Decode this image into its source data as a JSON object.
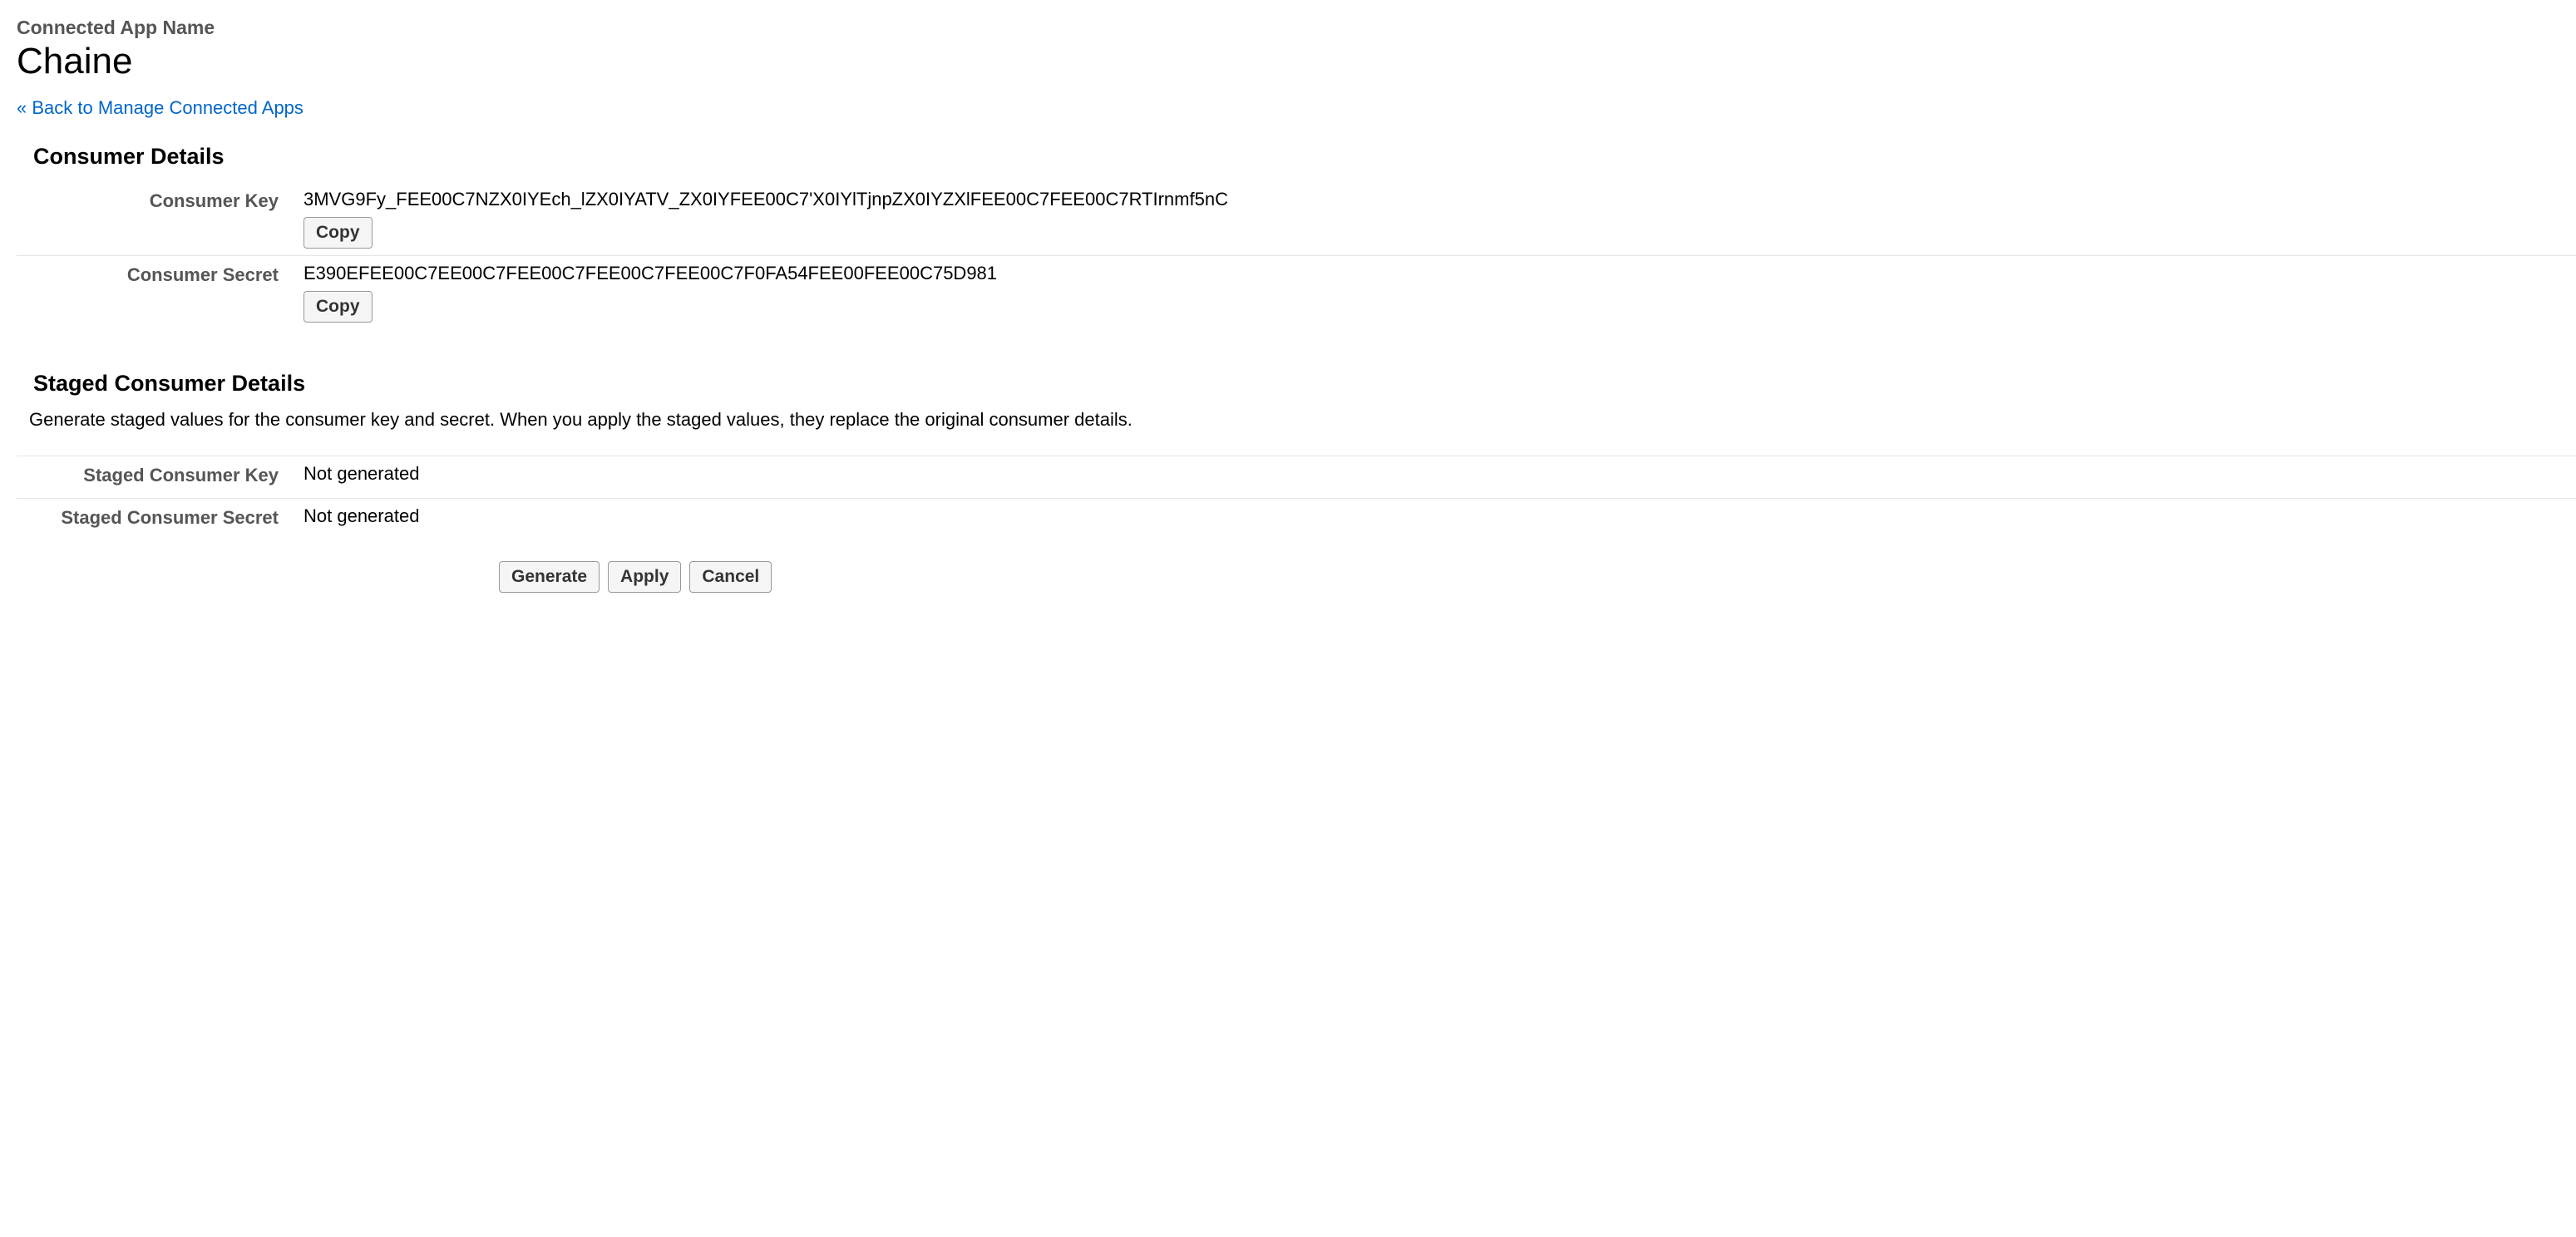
{
  "header": {
    "label": "Connected App Name",
    "title": "Chaine"
  },
  "back_link": {
    "prefix": "« ",
    "text": "Back to Manage Connected Apps"
  },
  "consumer_details": {
    "heading": "Consumer Details",
    "key_label": "Consumer Key",
    "key_value": "3MVG9Fy_FEE00C7NZX0IYEch_lZX0IYATV_ZX0IYFEE00C7'X0IYlTjnpZX0IYZXlFEE00C7FEE00C7RTIrnmf5nC",
    "secret_label": "Consumer Secret",
    "secret_value": "E390EFEE00C7EE00C7FEE00C7FEE00C7FEE00C7F0FA54FEE00FEE00C75D981",
    "copy_label": "Copy"
  },
  "staged_details": {
    "heading": "Staged Consumer Details",
    "description": "Generate staged values for the consumer key and secret. When you apply the staged values, they replace the original consumer details.",
    "key_label": "Staged Consumer Key",
    "key_value": "Not generated",
    "secret_label": "Staged Consumer Secret",
    "secret_value": "Not generated"
  },
  "buttons": {
    "generate": "Generate",
    "apply": "Apply",
    "cancel": "Cancel"
  }
}
